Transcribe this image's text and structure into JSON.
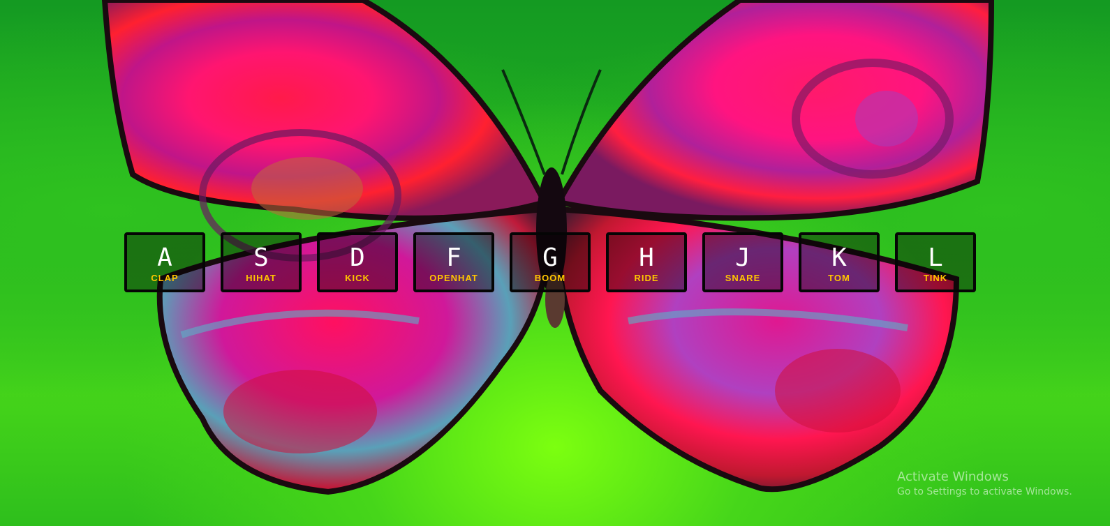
{
  "keys": [
    {
      "letter": "A",
      "sound": "CLAP"
    },
    {
      "letter": "S",
      "sound": "HIHAT"
    },
    {
      "letter": "D",
      "sound": "KICK"
    },
    {
      "letter": "F",
      "sound": "OPENHAT"
    },
    {
      "letter": "G",
      "sound": "BOOM"
    },
    {
      "letter": "H",
      "sound": "RIDE"
    },
    {
      "letter": "J",
      "sound": "SNARE"
    },
    {
      "letter": "K",
      "sound": "TOM"
    },
    {
      "letter": "L",
      "sound": "TINK"
    }
  ],
  "watermark": {
    "title": "Activate Windows",
    "subtitle": "Go to Settings to activate Windows."
  },
  "colors": {
    "key_letter": "#ffffff",
    "sound_label": "#ffc600",
    "key_border": "#050505"
  }
}
